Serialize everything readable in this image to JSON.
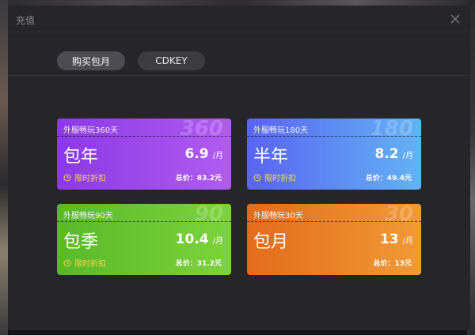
{
  "dialog": {
    "title": "充值"
  },
  "tabs": [
    {
      "label": "购买包月",
      "active": true
    },
    {
      "label": "CDKEY",
      "active": false
    }
  ],
  "plans": [
    {
      "days_label": "外服畅玩360天",
      "watermark": "360",
      "name": "包年",
      "price": "6.9",
      "unit": "/月",
      "promo": "限时折扣",
      "total": "总价：83.2元",
      "color": "#8a39e6"
    },
    {
      "days_label": "外服畅玩180天",
      "watermark": "180",
      "name": "半年",
      "price": "8.2",
      "unit": "/月",
      "promo": "限时折扣",
      "total": "总价：49.4元",
      "color": "#5a63f2"
    },
    {
      "days_label": "外服畅玩90天",
      "watermark": "90",
      "name": "包季",
      "price": "10.4",
      "unit": "/月",
      "promo": "限时折扣",
      "total": "总价：31.2元",
      "color": "#59b82a"
    },
    {
      "days_label": "外服畅玩30天",
      "watermark": "30",
      "name": "包月",
      "price": "13",
      "unit": "/月",
      "total": "总价：13元",
      "color": "#e26c1c"
    }
  ]
}
